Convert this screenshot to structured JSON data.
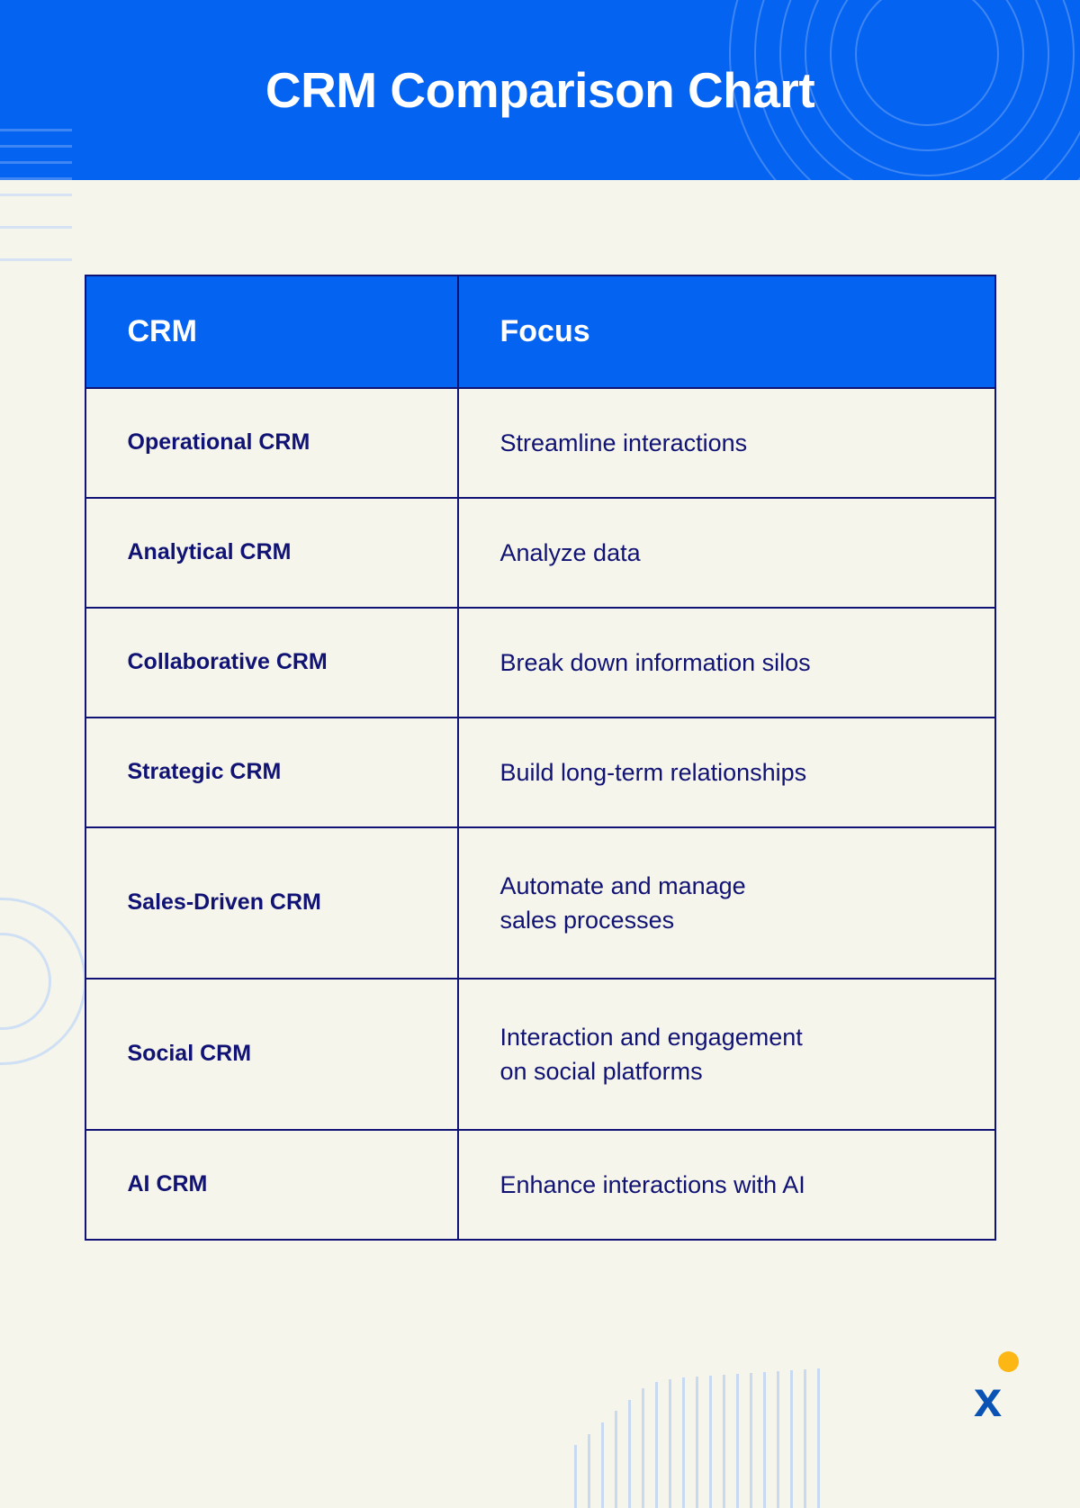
{
  "header": {
    "title": "CRM Comparison Chart",
    "background_color": "#0563f2",
    "title_color": "#ffffff"
  },
  "theme": {
    "page_background": "#f6f5ec",
    "accent_blue": "#0563f2",
    "text_navy": "#101374",
    "border_navy": "#101374",
    "hairline_blue": "#c8daf2",
    "logo_yellow": "#fdb714",
    "logo_blue": "#0a53b5"
  },
  "table": {
    "columns": [
      {
        "key": "crm",
        "label": "CRM"
      },
      {
        "key": "focus",
        "label": "Focus"
      }
    ],
    "rows": [
      {
        "crm": "Operational CRM",
        "focus": "Streamline interactions"
      },
      {
        "crm": "Analytical CRM",
        "focus": "Analyze data"
      },
      {
        "crm": "Collaborative CRM",
        "focus": "Break down information silos"
      },
      {
        "crm": "Strategic CRM",
        "focus": "Build long-term relationships"
      },
      {
        "crm": "Sales-Driven CRM",
        "focus": "Automate and manage\nsales processes"
      },
      {
        "crm": "Social CRM",
        "focus": "Interaction and engagement\non social platforms"
      },
      {
        "crm": "AI CRM",
        "focus": "Enhance interactions with AI"
      }
    ]
  },
  "footer": {
    "logo_letter": "x",
    "logo_name": "brand-x-logo"
  }
}
